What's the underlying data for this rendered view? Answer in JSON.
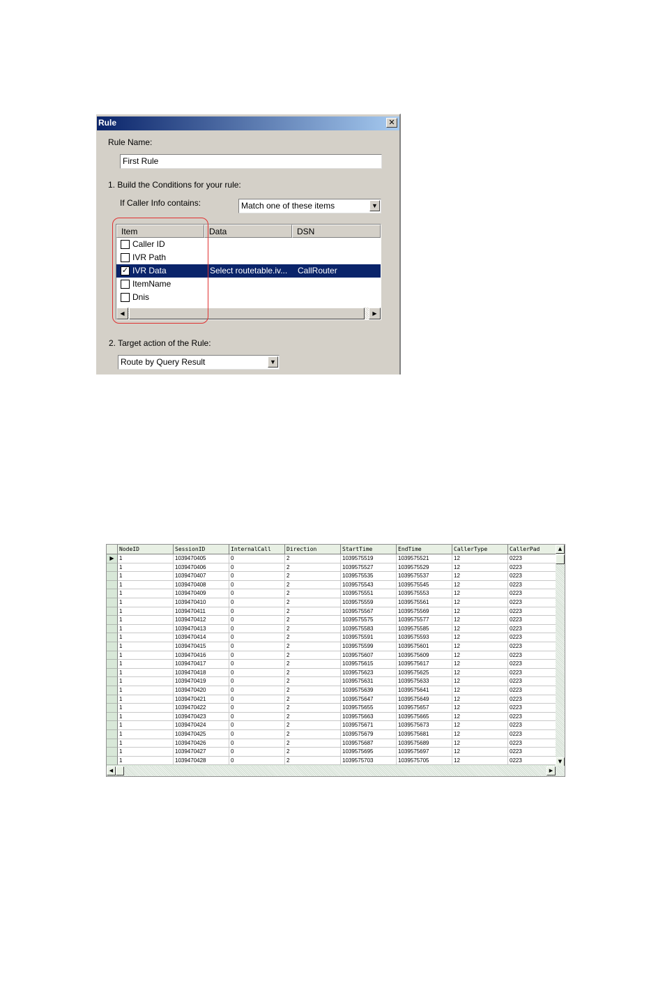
{
  "dialog": {
    "title": "Rule",
    "close_glyph": "✕",
    "rule_name_label": "Rule Name:",
    "rule_name_value": "First Rule",
    "step1_label": "1. Build the Conditions for your rule:",
    "caller_info_label": "If Caller Info contains:",
    "match_combo_value": "Match one of these items",
    "list": {
      "columns": [
        "Item",
        "Data",
        "DSN"
      ],
      "rows": [
        {
          "item": "Caller ID",
          "data": "",
          "dsn": "",
          "checked": false
        },
        {
          "item": "IVR Path",
          "data": "",
          "dsn": "",
          "checked": false
        },
        {
          "item": "IVR Data",
          "data": "Select routetable.iv...",
          "dsn": "CallRouter",
          "checked": true,
          "selected": true
        },
        {
          "item": "ItemName",
          "data": "",
          "dsn": "",
          "checked": false
        },
        {
          "item": "Dnis",
          "data": "",
          "dsn": "",
          "checked": false
        }
      ]
    },
    "step2_label": "2. Target action of the Rule:",
    "action_combo_value": "Route by Query Result",
    "highlight_color": "#e03030",
    "icons": {
      "checkbox": "checkbox-icon",
      "dropdown": "dropdown-arrow-icon",
      "scroll_left": "scroll-left-icon",
      "scroll_right": "scroll-right-icon",
      "close": "close-icon"
    }
  },
  "grid": {
    "columns": [
      "NodeID",
      "SessionID",
      "InternalCall",
      "Direction",
      "StartTime",
      "EndTime",
      "CallerType",
      "CallerPad"
    ],
    "current_row_marker": "▶",
    "rows": [
      [
        "1",
        "1039470405",
        "0",
        "2",
        "1039575519",
        "1039575521",
        "12",
        "0223"
      ],
      [
        "1",
        "1039470406",
        "0",
        "2",
        "1039575527",
        "1039575529",
        "12",
        "0223"
      ],
      [
        "1",
        "1039470407",
        "0",
        "2",
        "1039575535",
        "1039575537",
        "12",
        "0223"
      ],
      [
        "1",
        "1039470408",
        "0",
        "2",
        "1039575543",
        "1039575545",
        "12",
        "0223"
      ],
      [
        "1",
        "1039470409",
        "0",
        "2",
        "1039575551",
        "1039575553",
        "12",
        "0223"
      ],
      [
        "1",
        "1039470410",
        "0",
        "2",
        "1039575559",
        "1039575561",
        "12",
        "0223"
      ],
      [
        "1",
        "1039470411",
        "0",
        "2",
        "1039575567",
        "1039575569",
        "12",
        "0223"
      ],
      [
        "1",
        "1039470412",
        "0",
        "2",
        "1039575575",
        "1039575577",
        "12",
        "0223"
      ],
      [
        "1",
        "1039470413",
        "0",
        "2",
        "1039575583",
        "1039575585",
        "12",
        "0223"
      ],
      [
        "1",
        "1039470414",
        "0",
        "2",
        "1039575591",
        "1039575593",
        "12",
        "0223"
      ],
      [
        "1",
        "1039470415",
        "0",
        "2",
        "1039575599",
        "1039575601",
        "12",
        "0223"
      ],
      [
        "1",
        "1039470416",
        "0",
        "2",
        "1039575607",
        "1039575609",
        "12",
        "0223"
      ],
      [
        "1",
        "1039470417",
        "0",
        "2",
        "1039575615",
        "1039575617",
        "12",
        "0223"
      ],
      [
        "1",
        "1039470418",
        "0",
        "2",
        "1039575623",
        "1039575625",
        "12",
        "0223"
      ],
      [
        "1",
        "1039470419",
        "0",
        "2",
        "1039575631",
        "1039575633",
        "12",
        "0223"
      ],
      [
        "1",
        "1039470420",
        "0",
        "2",
        "1039575639",
        "1039575641",
        "12",
        "0223"
      ],
      [
        "1",
        "1039470421",
        "0",
        "2",
        "1039575647",
        "1039575649",
        "12",
        "0223"
      ],
      [
        "1",
        "1039470422",
        "0",
        "2",
        "1039575655",
        "1039575657",
        "12",
        "0223"
      ],
      [
        "1",
        "1039470423",
        "0",
        "2",
        "1039575663",
        "1039575665",
        "12",
        "0223"
      ],
      [
        "1",
        "1039470424",
        "0",
        "2",
        "1039575671",
        "1039575673",
        "12",
        "0223"
      ],
      [
        "1",
        "1039470425",
        "0",
        "2",
        "1039575679",
        "1039575681",
        "12",
        "0223"
      ],
      [
        "1",
        "1039470426",
        "0",
        "2",
        "1039575687",
        "1039575689",
        "12",
        "0223"
      ],
      [
        "1",
        "1039470427",
        "0",
        "2",
        "1039575695",
        "1039575697",
        "12",
        "0223"
      ],
      [
        "1",
        "1039470428",
        "0",
        "2",
        "1039575703",
        "1039575705",
        "12",
        "0223"
      ]
    ]
  }
}
